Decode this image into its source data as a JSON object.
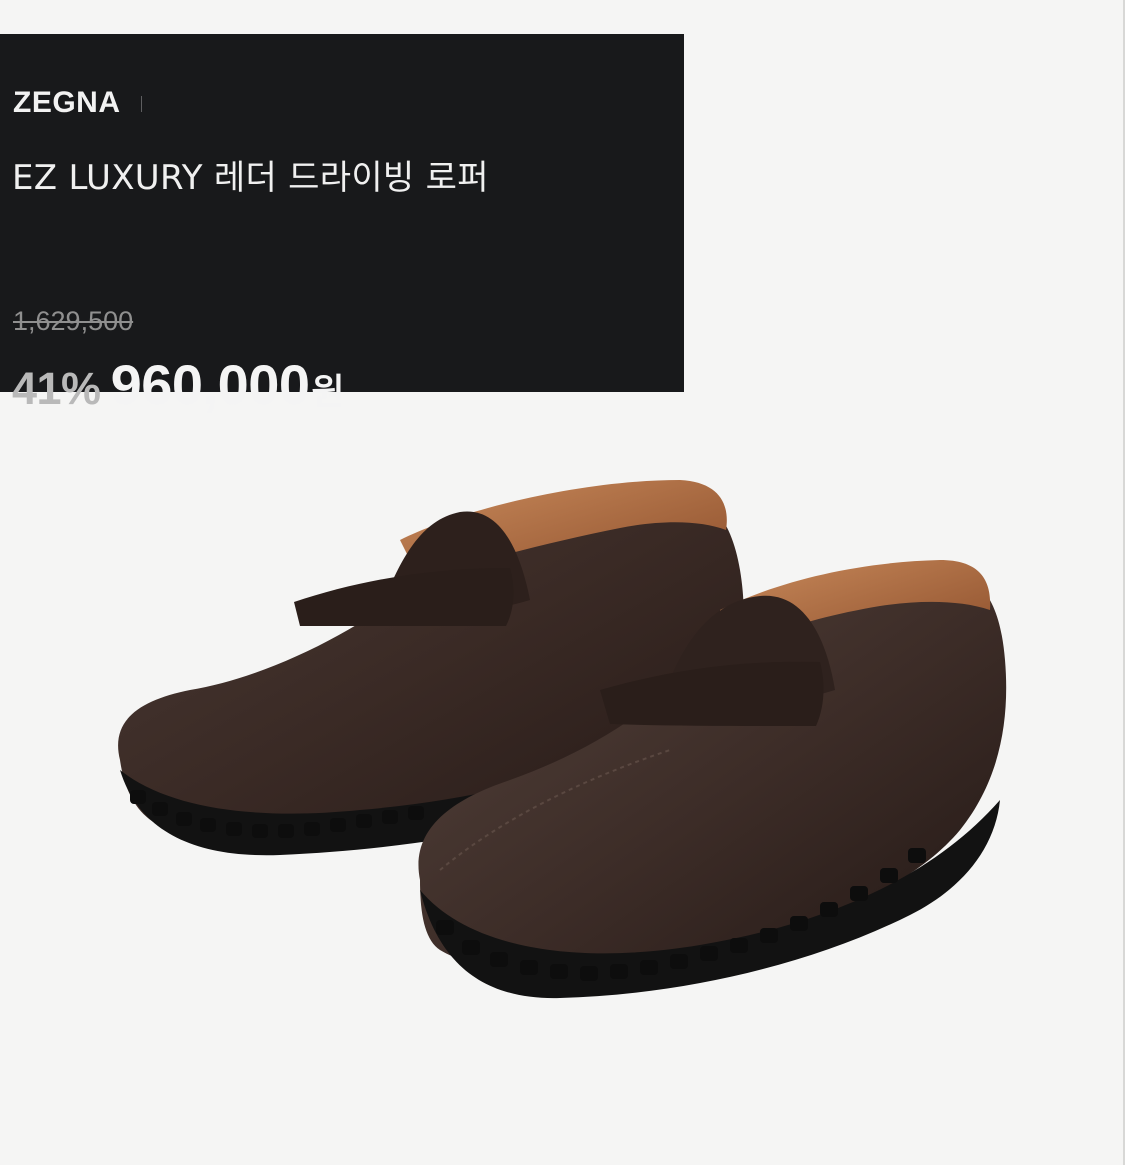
{
  "product": {
    "brand": "ZEGNA",
    "name": "EZ LUXURY 레더 드라이빙 로퍼",
    "original_price": "1,629,500",
    "discount": "41%",
    "sale_price": "960,000",
    "currency": "원"
  },
  "image": {
    "icon": "loafers-image",
    "colors": {
      "leather": "#3a2a25",
      "lining": "#a9673d",
      "sole": "#161616",
      "panel": "#18191b",
      "background": "#f5f5f4"
    }
  }
}
